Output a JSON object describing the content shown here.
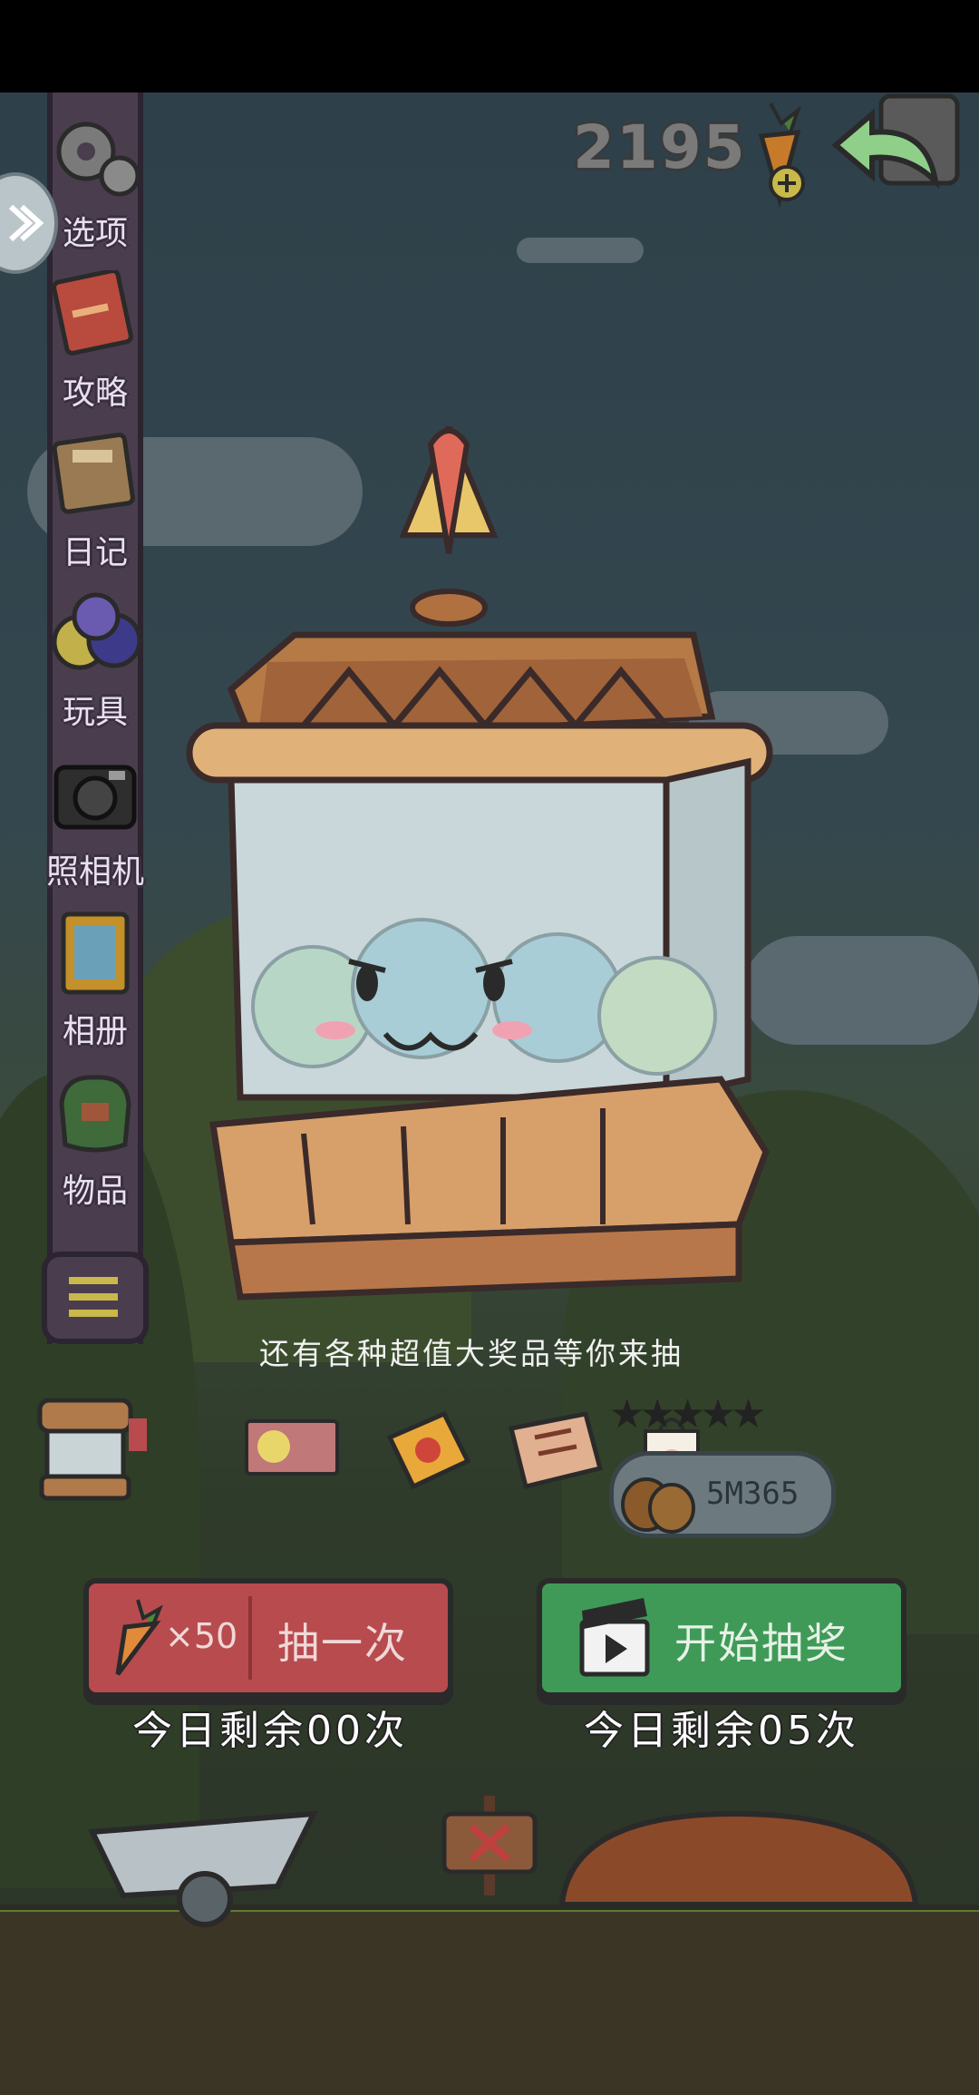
{
  "menu": {
    "items": [
      {
        "label": "选项",
        "icon": "gear-icon"
      },
      {
        "label": "攻略",
        "icon": "guide-book-icon"
      },
      {
        "label": "日记",
        "icon": "diary-icon"
      },
      {
        "label": "玩具",
        "icon": "toys-icon"
      },
      {
        "label": "照相机",
        "icon": "camera-icon"
      },
      {
        "label": "相册",
        "icon": "album-icon"
      },
      {
        "label": "物品",
        "icon": "items-bag-icon"
      }
    ]
  },
  "currency": {
    "amount": "2195"
  },
  "promo": {
    "text": "还有各种超值大奖品等你来抽"
  },
  "rating": {
    "stars": 5
  },
  "sign": {
    "text": "5M365"
  },
  "draw": {
    "cost": "×50",
    "label": "抽一次",
    "remaining": "今日剩余00次"
  },
  "start": {
    "label": "开始抽奖",
    "remaining": "今日剩余05次"
  },
  "colors": {
    "draw_button": "#b84b4e",
    "start_button": "#3f9a58"
  }
}
